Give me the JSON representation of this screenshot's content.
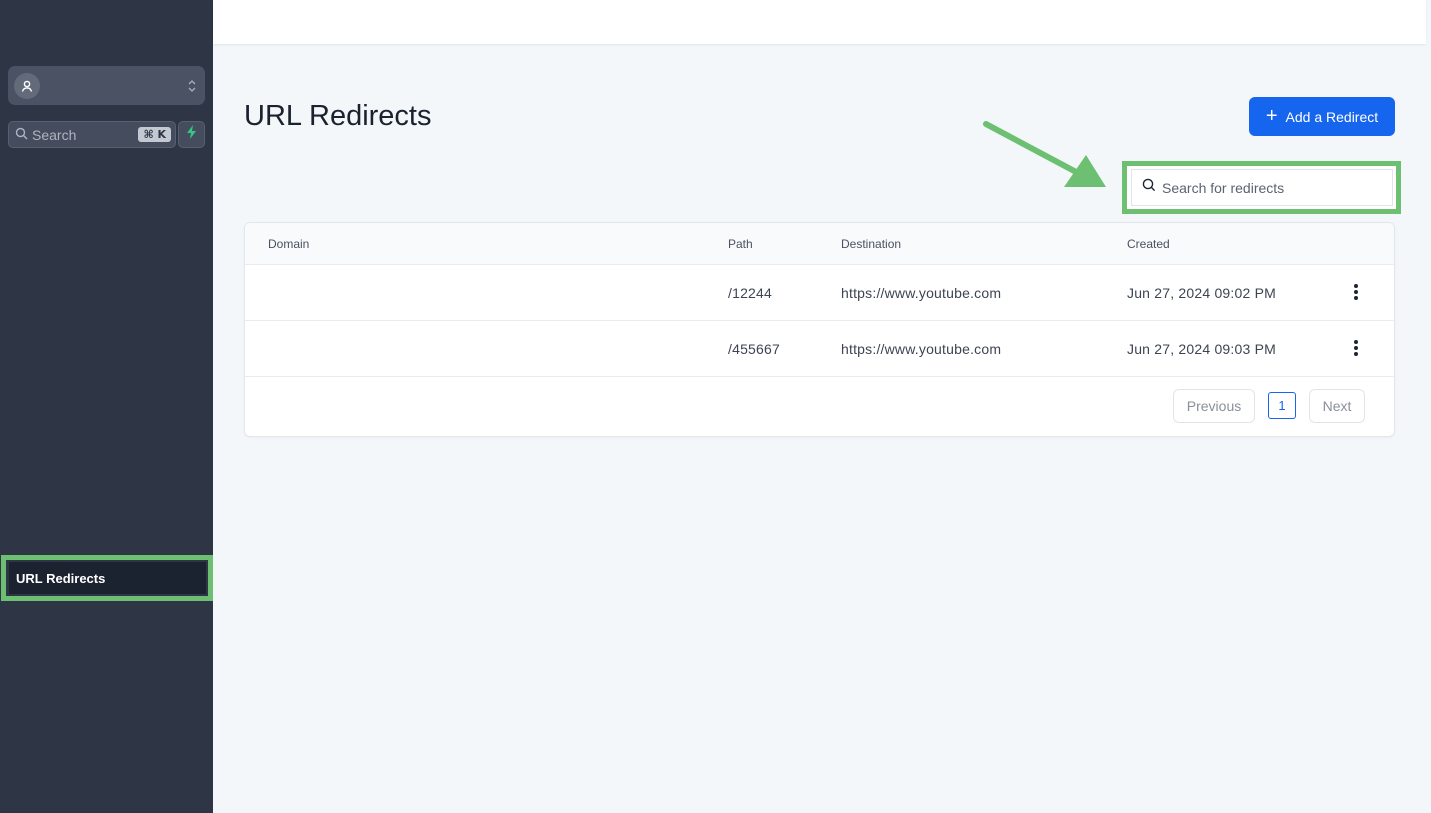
{
  "sidebar": {
    "search_label": "Search",
    "search_shortcut": "⌘ K",
    "nav_items": [
      {
        "label": "URL Redirects"
      }
    ]
  },
  "main": {
    "title": "URL Redirects",
    "add_button_label": "Add a Redirect",
    "search_placeholder": "Search for redirects"
  },
  "table": {
    "columns": [
      "Domain",
      "Path",
      "Destination",
      "Created"
    ],
    "rows": [
      {
        "domain": "",
        "path": "/12244",
        "destination": "https://www.youtube.com",
        "created": "Jun 27, 2024 09:02 PM"
      },
      {
        "domain": "",
        "path": "/455667",
        "destination": "https://www.youtube.com",
        "created": "Jun 27, 2024 09:03 PM"
      }
    ]
  },
  "pagination": {
    "previous_label": "Previous",
    "current_page": "1",
    "next_label": "Next"
  },
  "colors": {
    "sidebar_bg": "#2e3646",
    "primary": "#1565ee",
    "highlight": "#6dc072"
  },
  "icons": [
    "user-avatar-icon",
    "chevron-updown-icon",
    "search-icon",
    "lightning-bolt-icon",
    "plus-icon",
    "kebab-menu-icon",
    "annotation-arrow"
  ]
}
